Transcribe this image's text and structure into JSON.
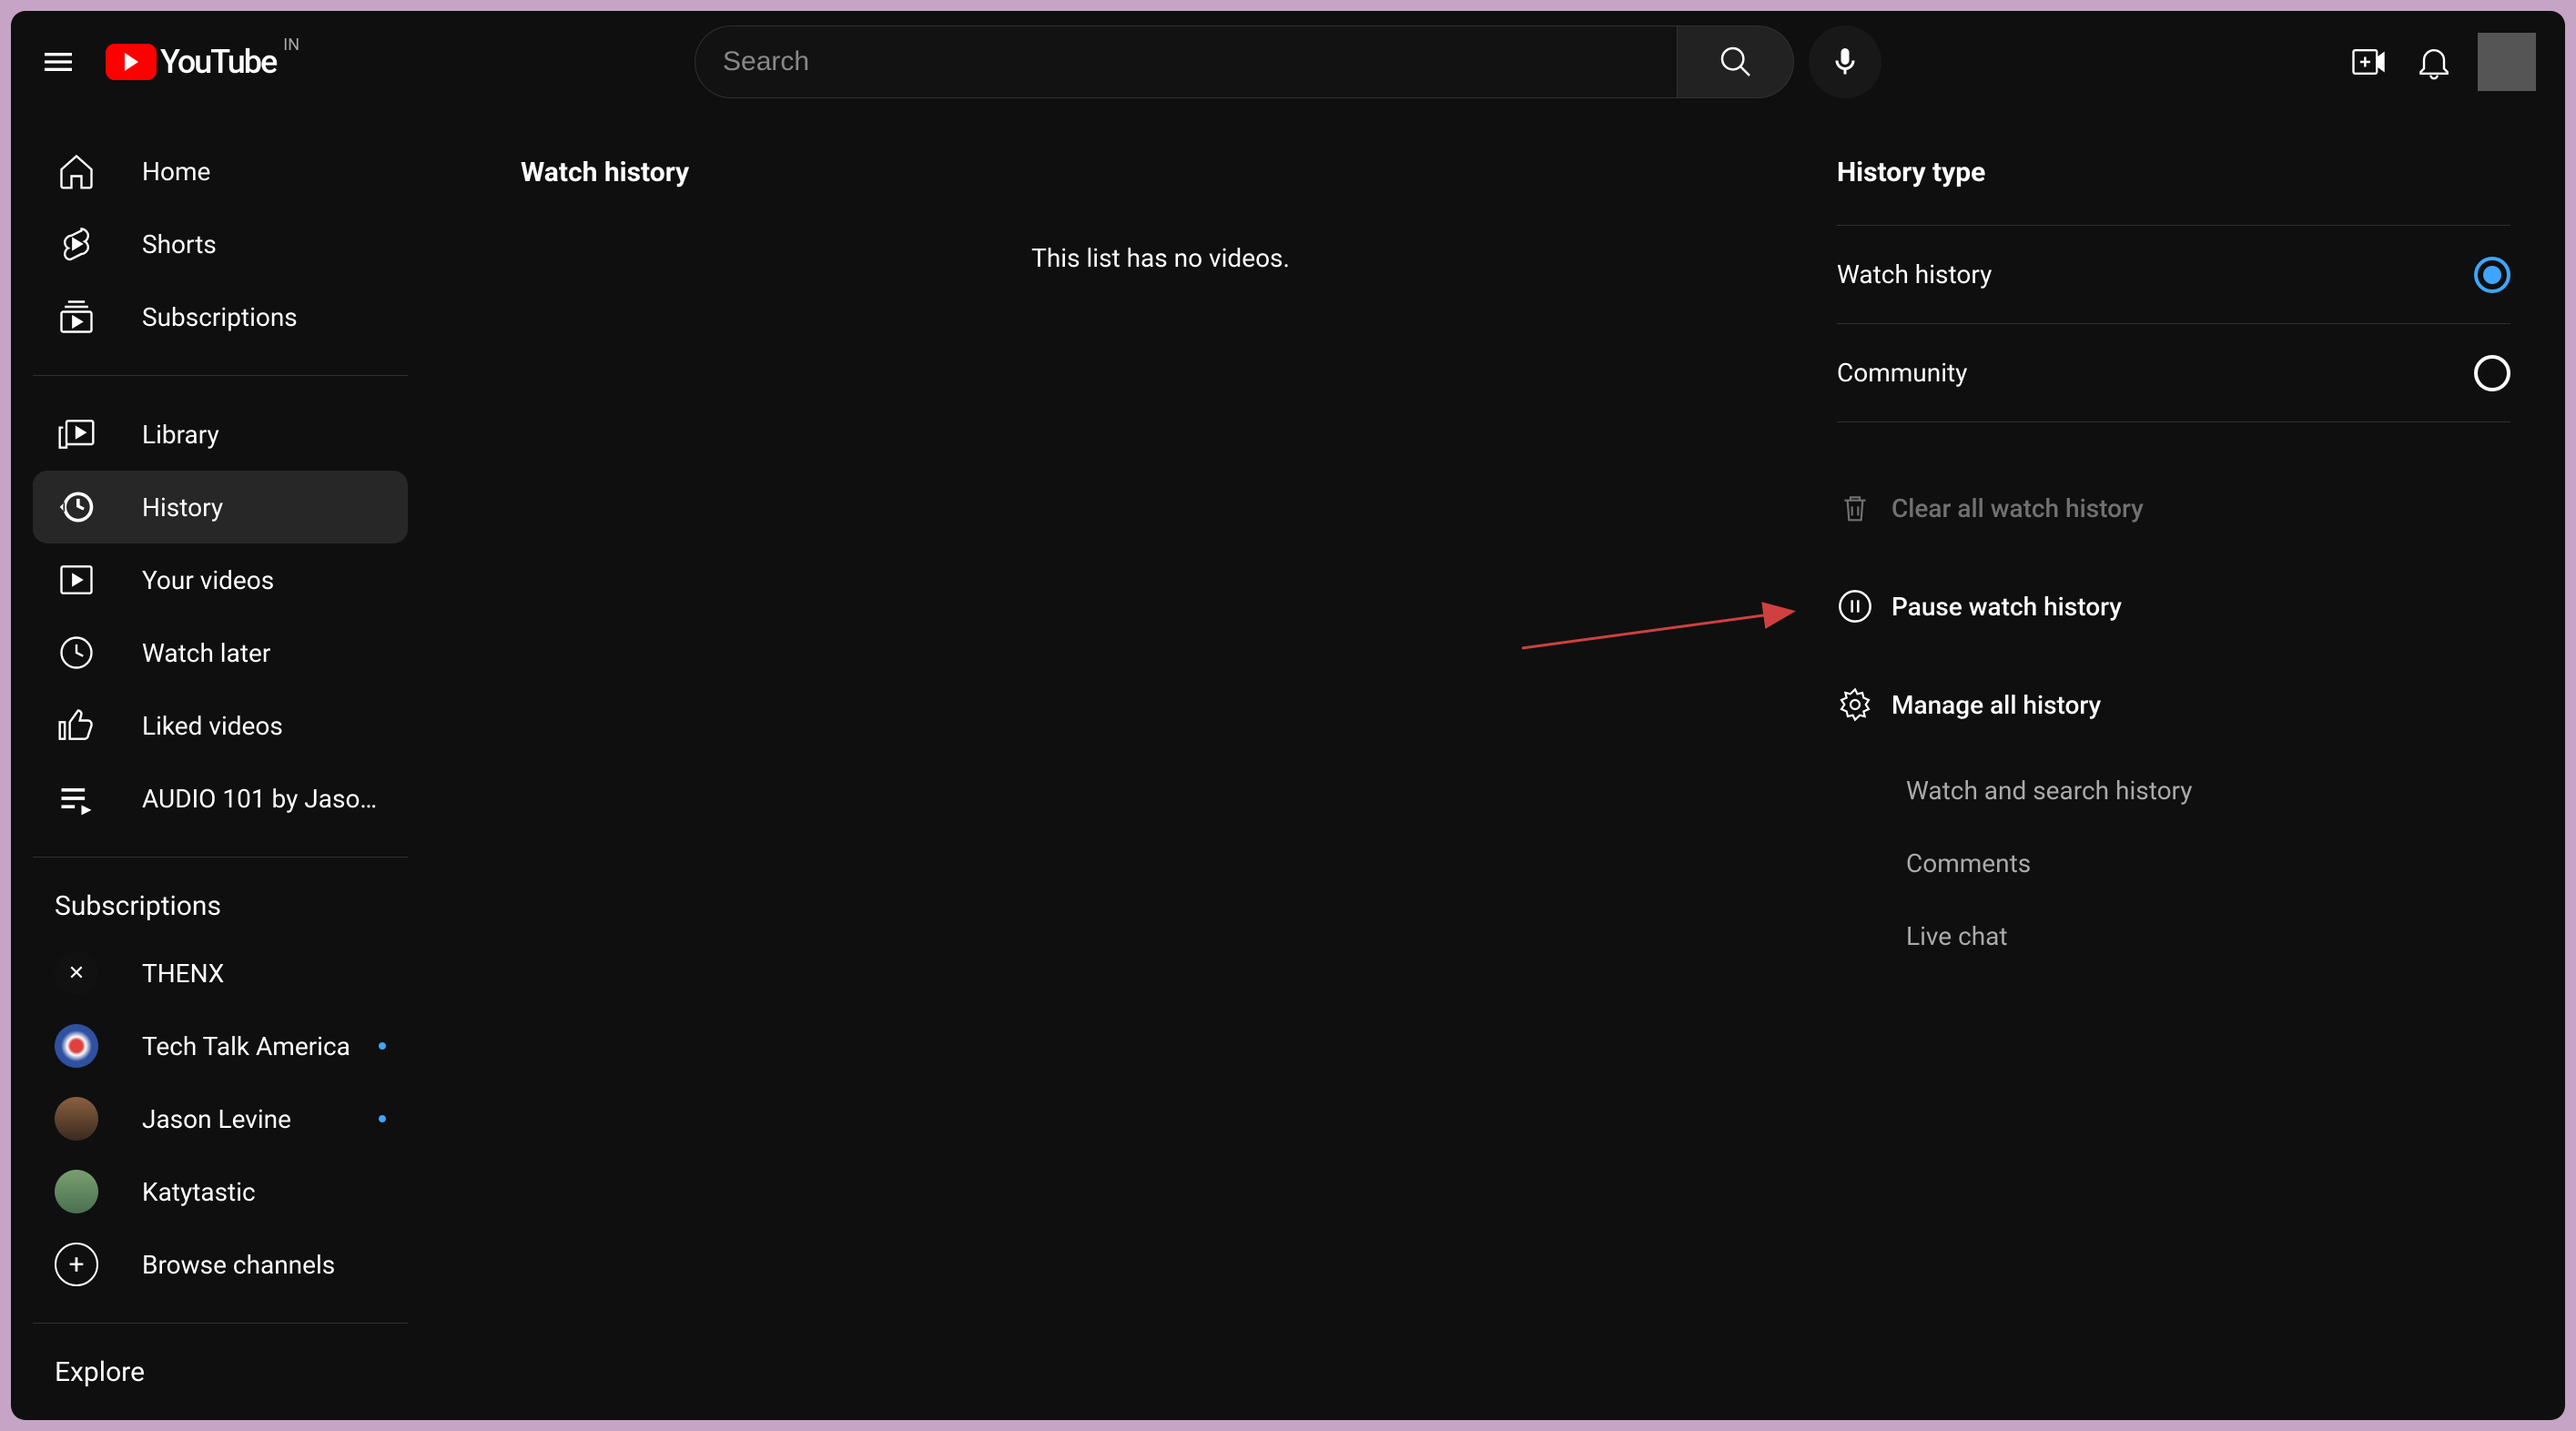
{
  "header": {
    "region": "IN",
    "logo_text": "YouTube",
    "search_placeholder": "Search"
  },
  "sidebar": {
    "main": [
      {
        "label": "Home"
      },
      {
        "label": "Shorts"
      },
      {
        "label": "Subscriptions"
      }
    ],
    "library": [
      {
        "label": "Library"
      },
      {
        "label": "History",
        "active": true
      },
      {
        "label": "Your videos"
      },
      {
        "label": "Watch later"
      },
      {
        "label": "Liked videos"
      },
      {
        "label": "AUDIO 101 by Jaso…"
      }
    ],
    "subs_heading": "Subscriptions",
    "subs": [
      {
        "label": "THENX",
        "dot": false
      },
      {
        "label": "Tech Talk America",
        "dot": true
      },
      {
        "label": "Jason Levine",
        "dot": true
      },
      {
        "label": "Katytastic",
        "dot": false
      }
    ],
    "browse_label": "Browse channels",
    "explore_heading": "Explore"
  },
  "content": {
    "title": "Watch history",
    "empty": "This list has no videos."
  },
  "panel": {
    "title": "History type",
    "types": [
      {
        "label": "Watch history",
        "selected": true
      },
      {
        "label": "Community",
        "selected": false
      }
    ],
    "actions": {
      "clear": "Clear all watch history",
      "pause": "Pause watch history",
      "manage": "Manage all history"
    },
    "links": [
      "Watch and search history",
      "Comments",
      "Live chat"
    ]
  }
}
